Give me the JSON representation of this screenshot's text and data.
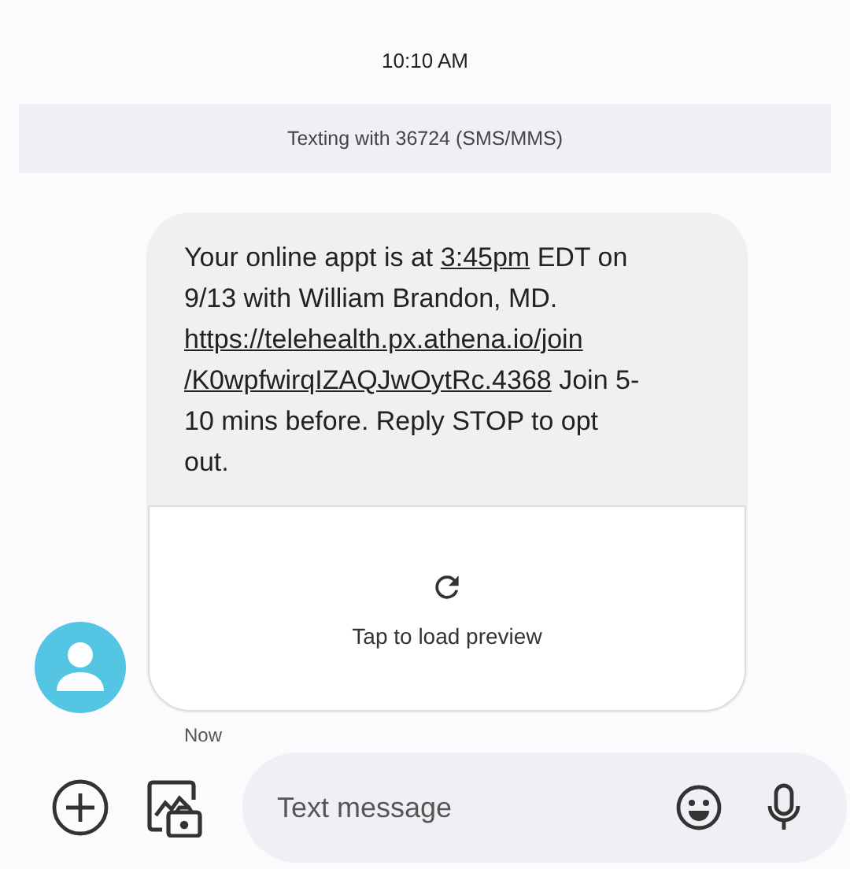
{
  "status_time": "10:10 AM",
  "banner": "Texting with 36724 (SMS/MMS)",
  "message": {
    "parts": [
      {
        "kind": "text",
        "text": "Your online appt is at "
      },
      {
        "kind": "link",
        "text": "3:45pm"
      },
      {
        "kind": "text",
        "text": " EDT on 9/13 with William Brandon, MD. "
      },
      {
        "kind": "link",
        "text": "https://telehealth.px.athena.io/join"
      },
      {
        "kind": "link",
        "text": "/K0wpfwirqIZAQJwOytRc.4368"
      },
      {
        "kind": "text",
        "text": " Join 5-10 mins before. Reply STOP to opt out."
      }
    ],
    "preview_label": "Tap to load preview",
    "time": "Now"
  },
  "composer": {
    "placeholder": "Text message"
  }
}
